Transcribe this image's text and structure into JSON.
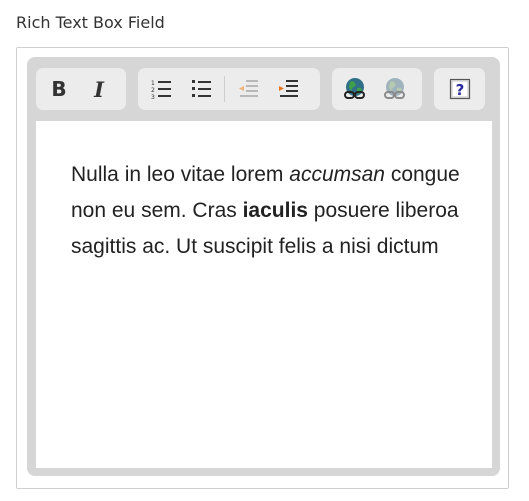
{
  "field": {
    "label": "Rich Text Box Field"
  },
  "toolbar": {
    "groups": [
      {
        "name": "format",
        "buttons": [
          {
            "id": "bold",
            "label": "B",
            "icon": "bold-icon"
          },
          {
            "id": "italic",
            "label": "I",
            "icon": "italic-icon"
          }
        ]
      },
      {
        "name": "lists-indent",
        "buttons": [
          {
            "id": "ordered-list",
            "icon": "ordered-list-icon"
          },
          {
            "id": "unordered-list",
            "icon": "unordered-list-icon"
          },
          {
            "id": "outdent",
            "icon": "outdent-icon"
          },
          {
            "id": "indent",
            "icon": "indent-icon"
          }
        ]
      },
      {
        "name": "links",
        "buttons": [
          {
            "id": "insert-link",
            "icon": "link-globe-icon"
          },
          {
            "id": "remove-link",
            "icon": "unlink-globe-icon"
          }
        ]
      },
      {
        "name": "help",
        "buttons": [
          {
            "id": "help",
            "label": "?",
            "icon": "help-icon"
          }
        ]
      }
    ]
  },
  "content": {
    "text_1": "Nulla in leo vitae lorem ",
    "italic_1": "accumsan",
    "text_2": " congue non eu sem. Cras ",
    "bold_1": "iaculis",
    "text_3": " posuere liberoa sagittis ac. Ut suscipit felis a nisi dictum"
  },
  "colors": {
    "frame": "#d6d6d6",
    "toolbar_group": "#ececec",
    "globe_active": "#2f6f88",
    "globe_inactive": "#9fb3bd",
    "help_blue": "#2b2b9a"
  }
}
